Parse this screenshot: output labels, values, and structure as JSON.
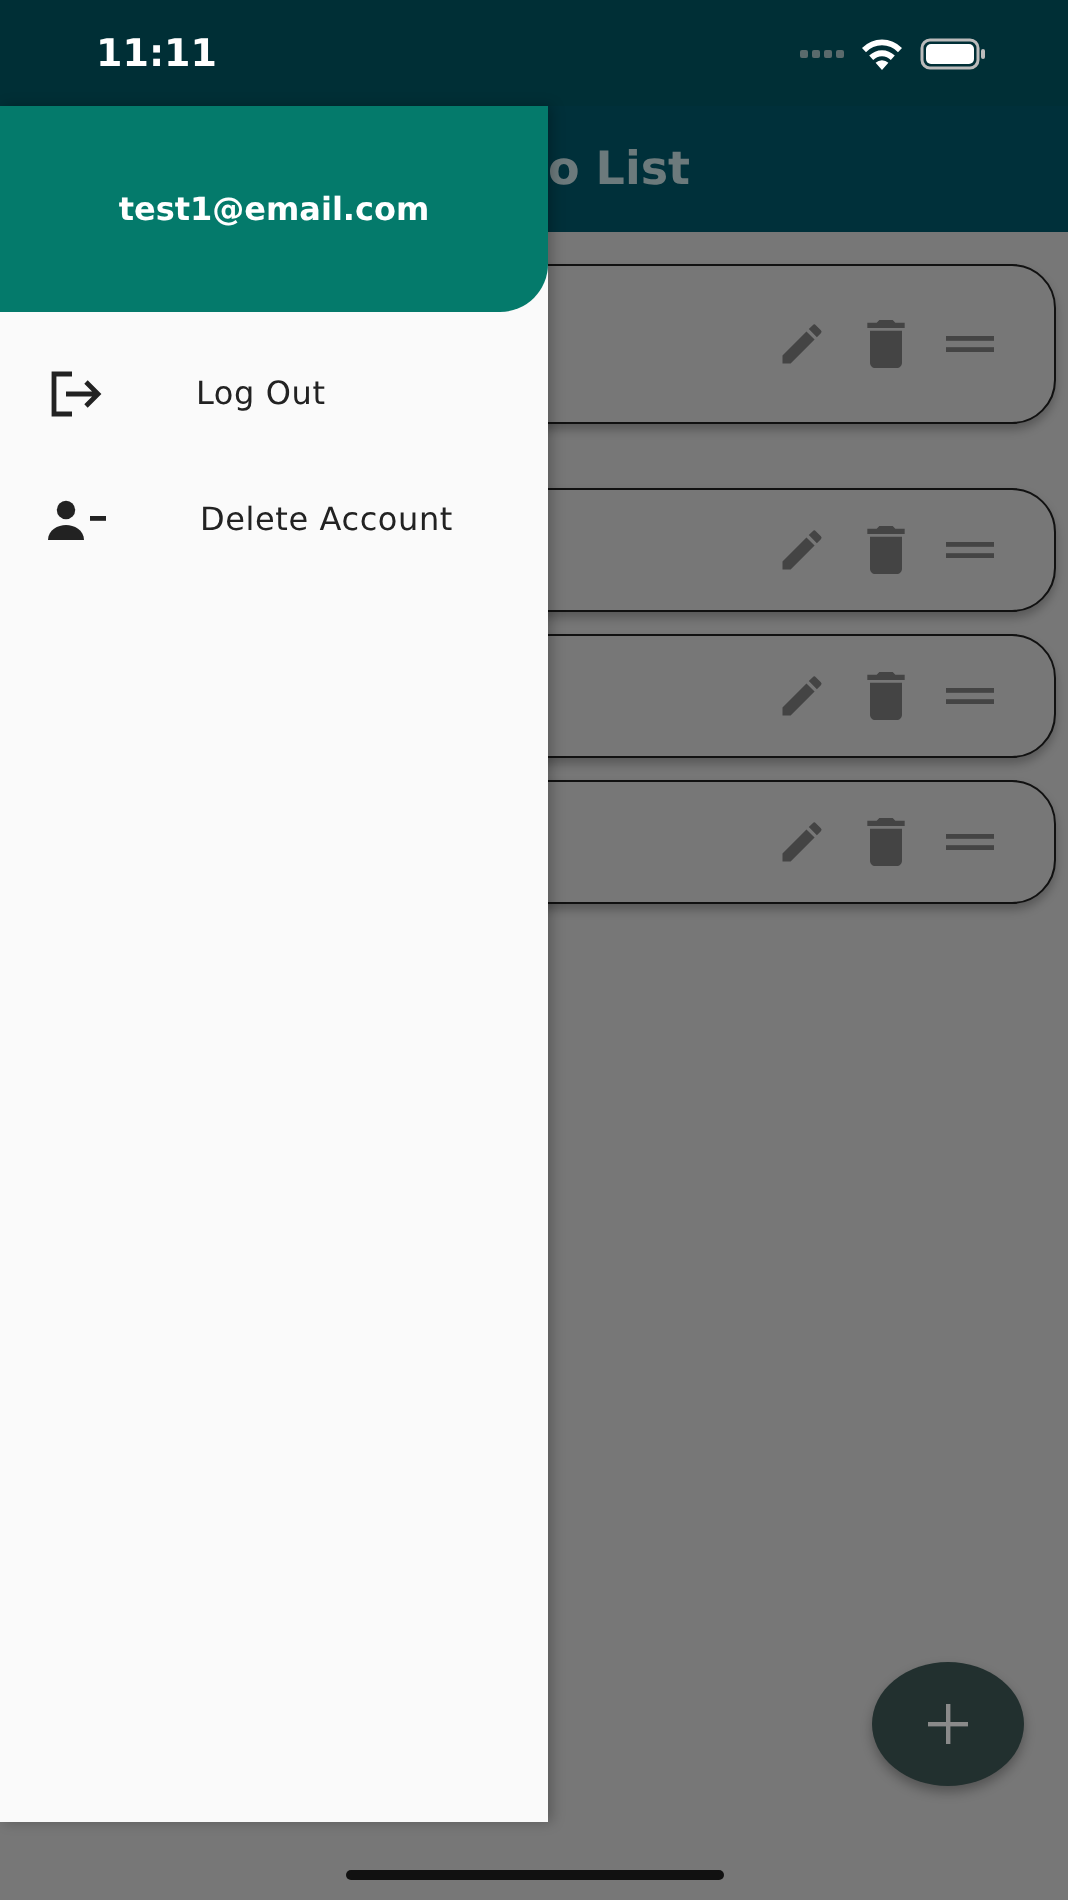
{
  "status_bar": {
    "time": "11:11"
  },
  "app_bar": {
    "title": "o List"
  },
  "cards": [
    {
      "kind": "tall"
    },
    {
      "kind": "regular"
    },
    {
      "kind": "regular"
    },
    {
      "kind": "regular"
    }
  ],
  "drawer": {
    "account_email": "test1@email.com",
    "items": [
      {
        "label": "Log Out"
      },
      {
        "label": "Delete Account"
      }
    ]
  }
}
